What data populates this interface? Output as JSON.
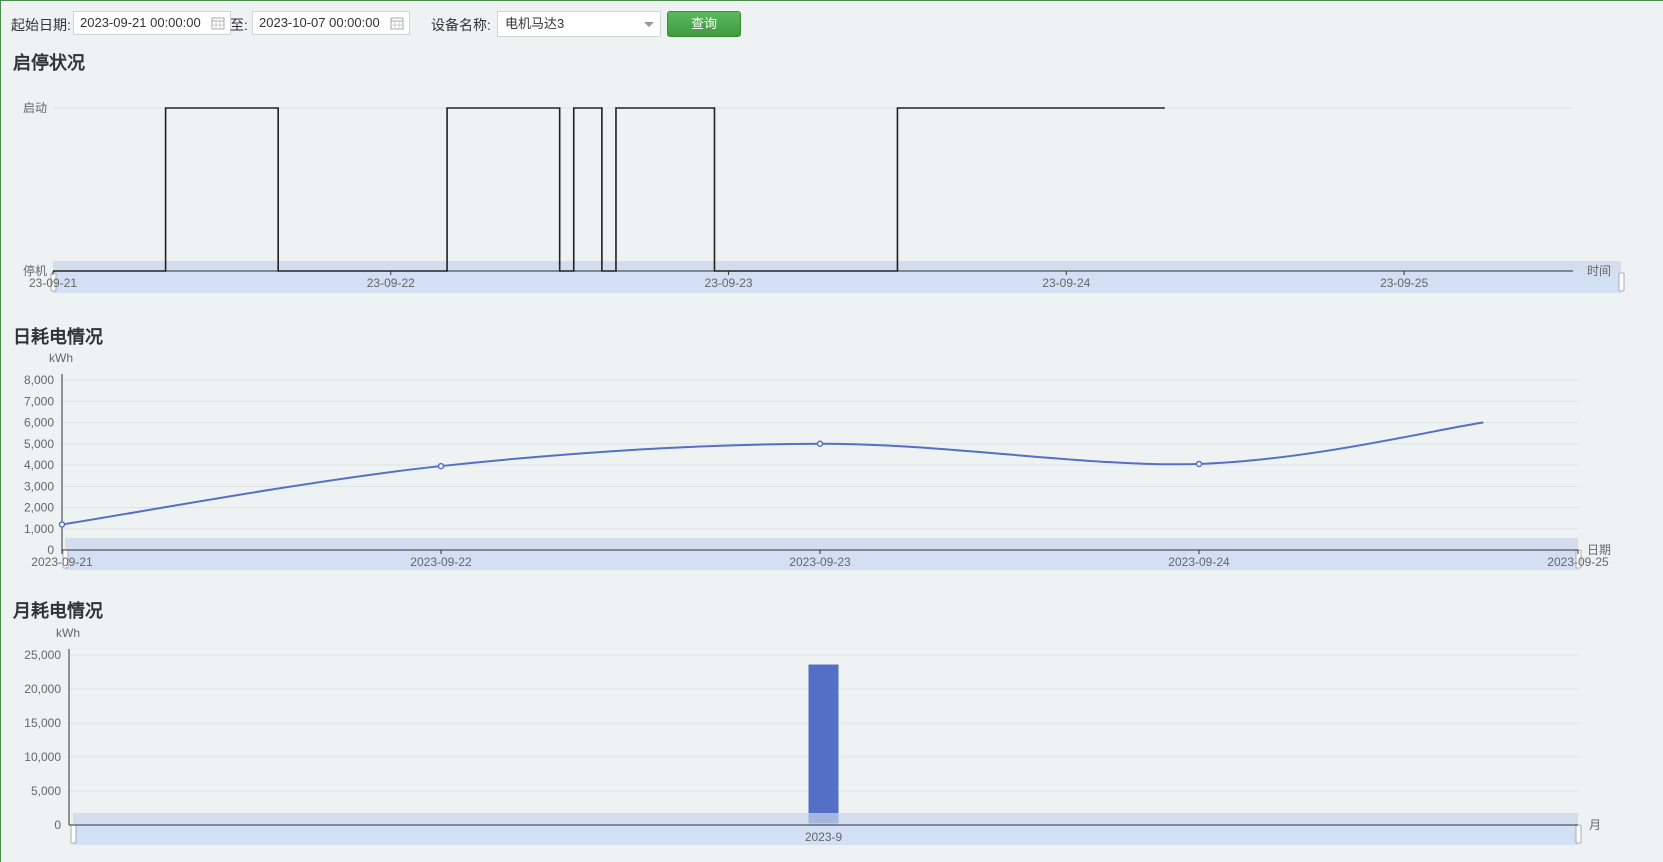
{
  "toolbar": {
    "start_label": "起始日期:",
    "start_value": "2023-09-21 00:00:00",
    "to_label": "至:",
    "end_value": "2023-10-07 00:00:00",
    "device_label": "设备名称:",
    "device_value": "电机马达3",
    "query_label": "查询"
  },
  "sections": {
    "status_title": "启停状况",
    "daily_title": "日耗电情况",
    "monthly_title": "月耗电情况"
  },
  "colors": {
    "accent": "#5470c6",
    "status_line": "#222222",
    "zoom_fill": "#cddcf5",
    "button": "#4caf50"
  },
  "chart_data": [
    {
      "type": "line",
      "step": true,
      "xlabel": "时间",
      "ylabel": "",
      "y_categories": [
        "停机",
        "启动"
      ],
      "x_ticks": [
        "23-09-21",
        "23-09-22",
        "23-09-23",
        "23-09-24",
        "23-09-25"
      ],
      "xlim": [
        "2023-09-21 00:00",
        "2023-09-25 12:00"
      ],
      "segments": [
        {
          "from": "2023-09-21 00:00",
          "to": "2023-09-21 08:00",
          "state": "停机"
        },
        {
          "from": "2023-09-21 08:00",
          "to": "2023-09-21 16:00",
          "state": "启动"
        },
        {
          "from": "2023-09-21 16:00",
          "to": "2023-09-22 04:00",
          "state": "停机"
        },
        {
          "from": "2023-09-22 04:00",
          "to": "2023-09-22 12:00",
          "state": "启动"
        },
        {
          "from": "2023-09-22 12:00",
          "to": "2023-09-22 13:00",
          "state": "停机"
        },
        {
          "from": "2023-09-22 13:00",
          "to": "2023-09-22 15:00",
          "state": "启动"
        },
        {
          "from": "2023-09-22 15:00",
          "to": "2023-09-22 16:00",
          "state": "停机"
        },
        {
          "from": "2023-09-22 16:00",
          "to": "2023-09-22 23:00",
          "state": "启动"
        },
        {
          "from": "2023-09-22 23:00",
          "to": "2023-09-23 12:00",
          "state": "停机"
        },
        {
          "from": "2023-09-23 12:00",
          "to": "2023-09-24 07:00",
          "state": "启动"
        }
      ],
      "grid": true,
      "data_zoom": true
    },
    {
      "type": "line",
      "smooth": true,
      "xlabel": "日期",
      "ylabel": "kWh",
      "categories": [
        "2023-09-21",
        "2023-09-22",
        "2023-09-23",
        "2023-09-24",
        "2023-09-25"
      ],
      "x_tick_labels": [
        "2023-09-21",
        "2023-09-22",
        "2023-09-23",
        "2023-09-24",
        "2023-09-25"
      ],
      "points": [
        {
          "x": "2023-09-21",
          "y": 1200
        },
        {
          "x": "2023-09-22",
          "y": 3950
        },
        {
          "x": "2023-09-23",
          "y": 5000
        },
        {
          "x": "2023-09-24",
          "y": 4050
        },
        {
          "x": "2023-09-24 18:00",
          "y": 6000
        }
      ],
      "ylim": [
        0,
        8000
      ],
      "yticks": [
        "0",
        "1,000",
        "2,000",
        "3,000",
        "4,000",
        "5,000",
        "6,000",
        "7,000",
        "8,000"
      ],
      "grid": true,
      "data_zoom": true
    },
    {
      "type": "bar",
      "xlabel": "月",
      "ylabel": "kWh",
      "categories": [
        "2023-9"
      ],
      "values": [
        23600
      ],
      "ylim": [
        0,
        25000
      ],
      "yticks": [
        "0",
        "5,000",
        "10,000",
        "15,000",
        "20,000",
        "25,000"
      ],
      "grid": true,
      "data_zoom": true
    }
  ]
}
